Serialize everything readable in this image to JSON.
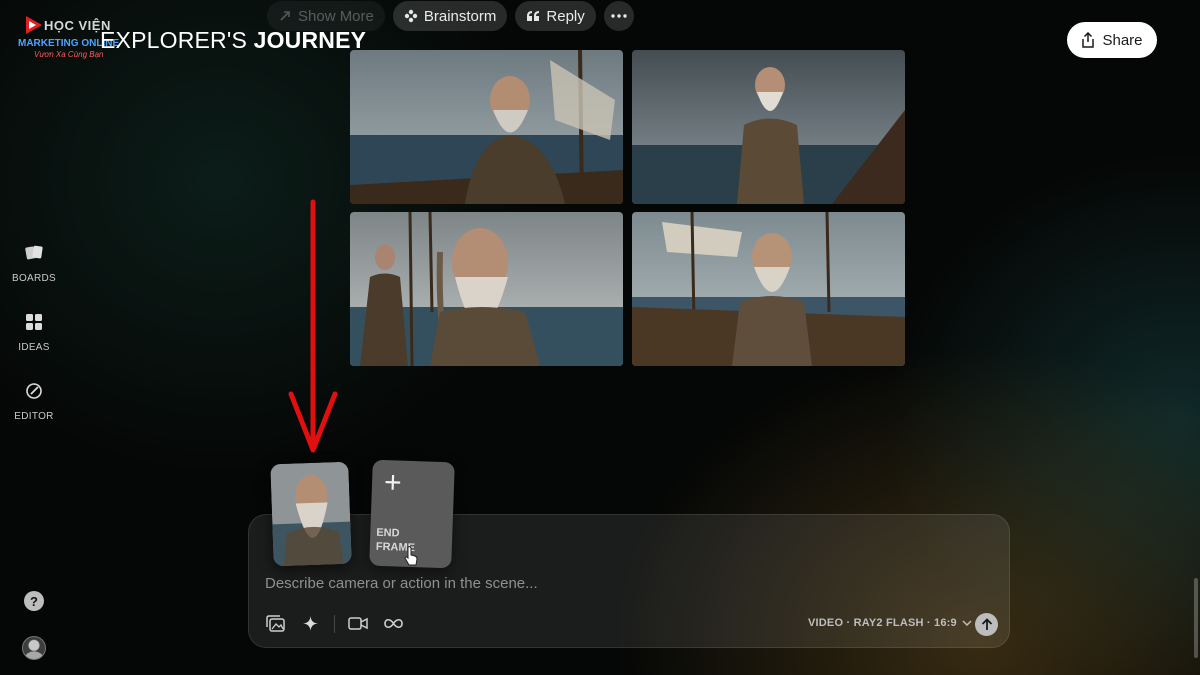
{
  "watermark": {
    "line1": "HỌC VIỆN",
    "line2": "MARKETING ONLINE",
    "line3": "Vươn Xa Cùng Bạn"
  },
  "header": {
    "title_light": "EXPLORER'S",
    "title_bold": "JOURNEY"
  },
  "toolbar": {
    "show_more_label": "Show More",
    "brainstorm_label": "Brainstorm",
    "reply_label": "Reply",
    "more_icon": "ellipsis-icon"
  },
  "share": {
    "label": "Share",
    "icon": "share-icon"
  },
  "sidebar": {
    "items": [
      {
        "label": "BOARDS",
        "icon": "boards-icon"
      },
      {
        "label": "IDEAS",
        "icon": "ideas-icon"
      },
      {
        "label": "EDITOR",
        "icon": "editor-icon"
      }
    ],
    "help_label": "?"
  },
  "grid": {
    "images": [
      {
        "description_icon": "image-bearded-sailor-1"
      },
      {
        "description_icon": "image-bearded-sailor-2"
      },
      {
        "description_icon": "image-bearded-sailor-3"
      },
      {
        "description_icon": "image-bearded-sailor-4"
      }
    ]
  },
  "composer": {
    "end_frame_plus": "+",
    "end_frame_label": "END FRAME",
    "placeholder": "Describe camera or action in the scene...",
    "model_label": "VIDEO · RAY2 FLASH · 16:9"
  },
  "colors": {
    "background": "#050706",
    "share_bg": "#ffffff",
    "annotation_arrow": "#e01010",
    "logo_blue": "#4da3ff",
    "logo_red": "#ff5a5a"
  }
}
